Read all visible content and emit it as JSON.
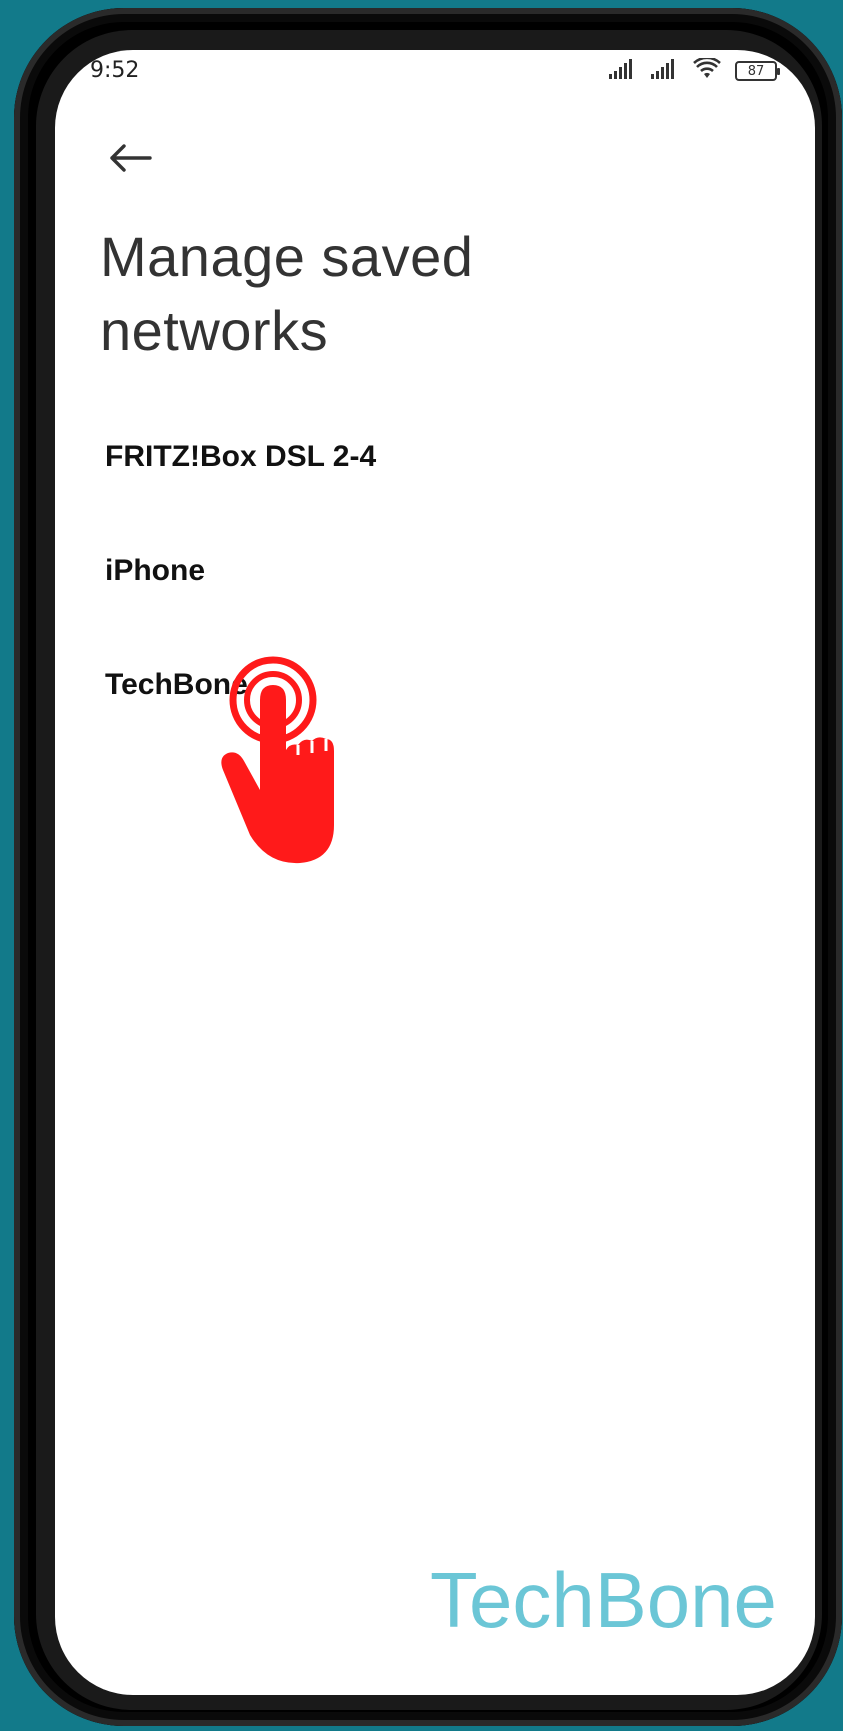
{
  "status_bar": {
    "time": "9:52",
    "battery": "87",
    "icons": [
      "signal-icon",
      "signal-icon",
      "wifi-icon",
      "battery-icon"
    ]
  },
  "header": {
    "back_icon": "arrow-left-icon",
    "title": "Manage saved networks"
  },
  "networks": [
    {
      "label": "FRITZ!Box DSL 2-4"
    },
    {
      "label": "iPhone"
    },
    {
      "label": "TechBone"
    }
  ],
  "overlay": {
    "tap_icon": "tap-hand-icon",
    "color": "#ff1a1a"
  },
  "watermark": "TechBone",
  "colors": {
    "background": "#127a8a",
    "watermark": "#5cc0d2"
  }
}
